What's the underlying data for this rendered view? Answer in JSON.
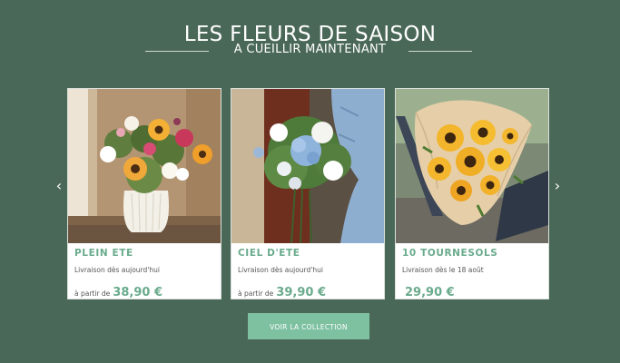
{
  "header": {
    "title": "LES FLEURS DE SAISON",
    "subtitle": "A CUEILLIR MAINTENANT"
  },
  "carousel": {
    "prev_icon": "chevron-left-icon",
    "next_icon": "chevron-right-icon",
    "prev_glyph": "‹",
    "next_glyph": "›",
    "products": [
      {
        "name": "PLEIN ETE",
        "delivery": "Livraison dès aujourd'hui",
        "price_prefix": "à partir de",
        "price": "38,90 €"
      },
      {
        "name": "CIEL D'ETE",
        "delivery": "Livraison dès aujourd'hui",
        "price_prefix": "à partir de",
        "price": "39,90 €"
      },
      {
        "name": "10 TOURNESOLS",
        "delivery": "Livraison dès le 18 août",
        "price_prefix": "",
        "price": "29,90 €"
      }
    ]
  },
  "cta": {
    "label": "VOIR LA COLLECTION"
  },
  "colors": {
    "background": "#4a6858",
    "accent": "#6aab8c",
    "button": "#7ec1a1"
  }
}
